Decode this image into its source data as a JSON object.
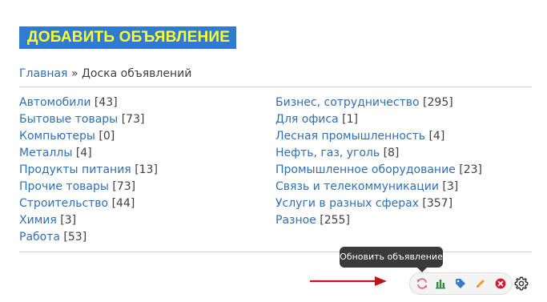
{
  "header": {
    "add_ad_label": "ДОБАВИТЬ ОБЪЯВЛЕНИЕ"
  },
  "breadcrumb": {
    "home": "Главная",
    "separator": "»",
    "current": "Доска объявлений"
  },
  "categories": {
    "left": [
      {
        "name": "Автомобили",
        "count": "[43]"
      },
      {
        "name": "Бытовые товары",
        "count": "[73]"
      },
      {
        "name": "Компьютеры",
        "count": "[0]"
      },
      {
        "name": "Металлы",
        "count": "[4]"
      },
      {
        "name": "Продукты питания",
        "count": "[13]"
      },
      {
        "name": "Прочие товары",
        "count": "[73]"
      },
      {
        "name": "Строительство",
        "count": "[44]"
      },
      {
        "name": "Химия",
        "count": "[3]"
      },
      {
        "name": "Работа",
        "count": "[53]"
      }
    ],
    "right": [
      {
        "name": "Бизнес, сотрудничество",
        "count": "[295]"
      },
      {
        "name": "Для офиса",
        "count": "[1]"
      },
      {
        "name": "Лесная промышленность",
        "count": "[4]"
      },
      {
        "name": "Нефть, газ, уголь",
        "count": "[8]"
      },
      {
        "name": "Промышленное оборудование",
        "count": "[23]"
      },
      {
        "name": "Связь и телекоммуникации",
        "count": "[3]"
      },
      {
        "name": "Услуги в разных сферах",
        "count": "[357]"
      },
      {
        "name": "Разное",
        "count": "[255]"
      }
    ]
  },
  "tooltip": {
    "text": "Обновить объявление"
  },
  "toolbar": {
    "icons": [
      "refresh-icon",
      "stats-icon",
      "tag-icon",
      "pencil-icon",
      "delete-icon",
      "gear-icon"
    ]
  },
  "colors": {
    "link": "#2f6fb3",
    "button_bg": "#2f7bd0",
    "button_text": "#ffff33",
    "arrow": "#c0141c",
    "tooltip_bg": "#3a3a3a"
  }
}
